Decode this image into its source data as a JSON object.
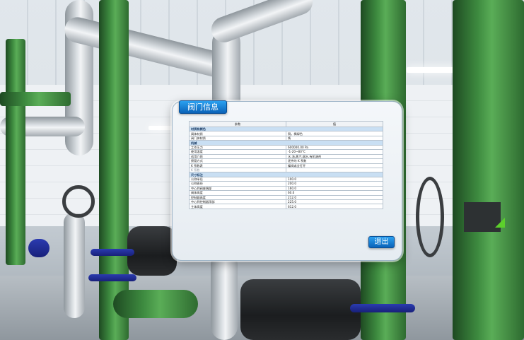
{
  "dialog": {
    "title": "阀门信息",
    "exit_label": "退出",
    "table": {
      "headers": [
        "参数",
        "值"
      ],
      "sections": [
        {
          "title": "材质和颜色",
          "rows": [
            {
              "key": "阀体材质",
              "value": "铜，褐绿色"
            },
            {
              "key": "阀门体材质",
              "value": "铸"
            }
          ]
        },
        {
          "title": "机械",
          "rows": [
            {
              "key": "工作压力",
              "value": "600000.00 Pa"
            },
            {
              "key": "使用温度",
              "value": "-1-20~80°C"
            },
            {
              "key": "适用介质",
              "value": "水,油,蒸汽,弱水,有机溶剂"
            },
            {
              "key": "接管方式",
              "value": "逐件的 K 系数"
            },
            {
              "key": "K 系数表",
              "value": "蝶阀或全打开"
            },
            {
              "key": "K 系数",
              "value": ""
            }
          ]
        },
        {
          "title": "尺寸标注",
          "rows": [
            {
              "key": "公称半径",
              "value": "100.0"
            },
            {
              "key": "公称直径",
              "value": "200.0"
            },
            {
              "key": "中心到阀座端部",
              "value": "160.0"
            },
            {
              "key": "阀体高度",
              "value": "60.0"
            },
            {
              "key": "控制器高度",
              "value": "212.0"
            },
            {
              "key": "中心到控制器顶部",
              "value": "225.0"
            },
            {
              "key": "主体高度",
              "value": "612.0"
            }
          ]
        }
      ]
    }
  }
}
